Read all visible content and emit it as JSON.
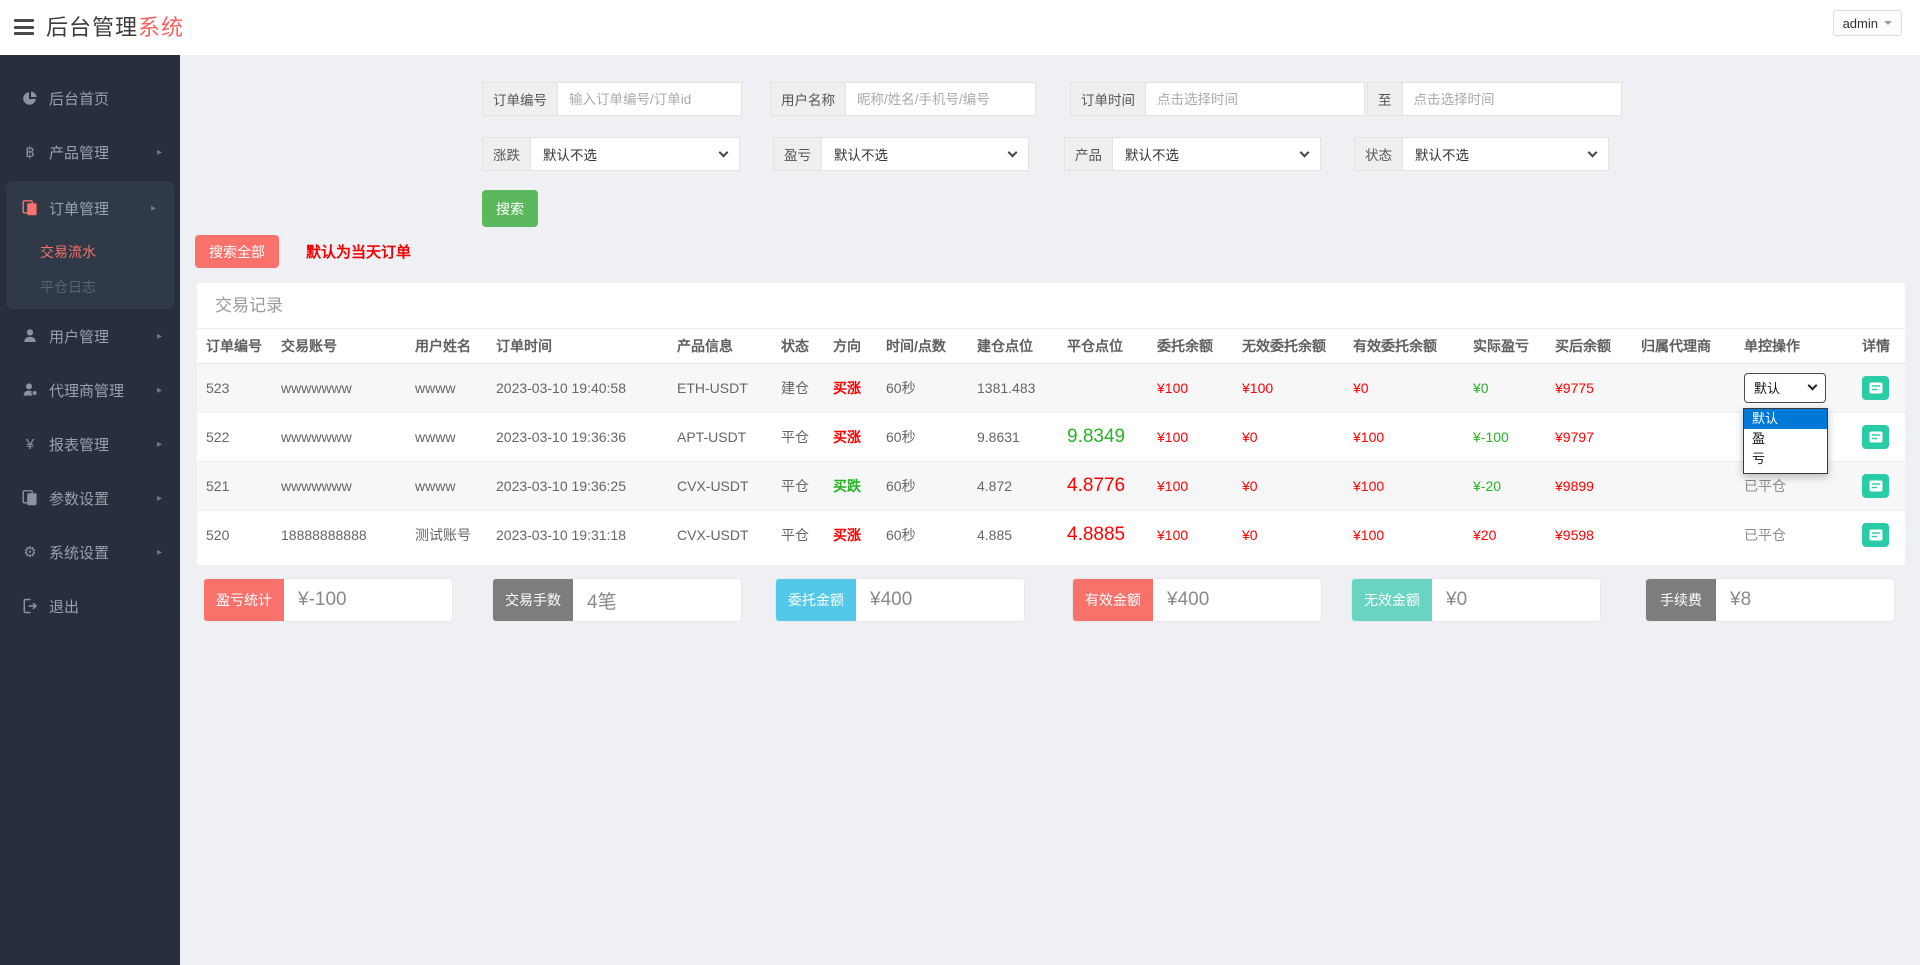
{
  "app": {
    "title_primary": "后台管理",
    "title_accent": "系统",
    "user_menu": "admin"
  },
  "sidebar": {
    "items": [
      {
        "label": "后台首页",
        "icon": "dashboard-icon"
      },
      {
        "label": "产品管理",
        "icon": "product-icon",
        "has_children": true
      },
      {
        "label": "订单管理",
        "icon": "orders-icon",
        "has_children": true,
        "expanded": true,
        "children": [
          {
            "label": "交易流水",
            "active": true
          },
          {
            "label": "平仓日志"
          }
        ]
      },
      {
        "label": "用户管理",
        "icon": "user-icon",
        "has_children": true
      },
      {
        "label": "代理商管理",
        "icon": "agent-icon",
        "has_children": true
      },
      {
        "label": "报表管理",
        "icon": "report-icon",
        "has_children": true
      },
      {
        "label": "参数设置",
        "icon": "params-icon",
        "has_children": true
      },
      {
        "label": "系统设置",
        "icon": "settings-icon",
        "has_children": true
      },
      {
        "label": "退出",
        "icon": "logout-icon"
      }
    ]
  },
  "filters": {
    "order_no": {
      "label": "订单编号",
      "placeholder": "输入订单编号/订单id"
    },
    "user_name": {
      "label": "用户名称",
      "placeholder": "昵称/姓名/手机号/编号"
    },
    "time_range": {
      "label": "订单时间",
      "placeholder_from": "点击选择时间",
      "to": "至",
      "placeholder_to": "点击选择时间"
    },
    "rise_fall": {
      "label": "涨跌",
      "selected": "默认不选"
    },
    "profit_loss": {
      "label": "盈亏",
      "selected": "默认不选"
    },
    "product": {
      "label": "产品",
      "selected": "默认不选"
    },
    "status": {
      "label": "状态",
      "selected": "默认不选"
    },
    "search": "搜索",
    "search_all": "搜索全部",
    "hint": "默认为当天订单"
  },
  "table": {
    "title": "交易记录",
    "columns": [
      "订单编号",
      "交易账号",
      "用户姓名",
      "订单时间",
      "产品信息",
      "状态",
      "方向",
      "时间/点数",
      "建仓点位",
      "平仓点位",
      "委托余额",
      "无效委托余额",
      "有效委托余额",
      "实际盈亏",
      "买后余额",
      "归属代理商",
      "单控操作",
      "详情"
    ],
    "control_dropdown": {
      "value": "默认",
      "options": [
        "默认",
        "盈",
        "亏"
      ],
      "highlighted": "默认"
    },
    "closed_label": "已平仓",
    "rows": [
      {
        "id": "523",
        "account": "wwwwwww",
        "username": "wwww",
        "time": "2023-03-10 19:40:58",
        "product": "ETH-USDT",
        "status": "建仓",
        "direction": "买涨",
        "period": "60秒",
        "open_point": "1381.483",
        "close_point": "",
        "entrust": "¥100",
        "invalid_entrust": "¥100",
        "valid_entrust": "¥0",
        "profit": "¥0",
        "balance": "¥9775",
        "agent": "",
        "control": "dropdown"
      },
      {
        "id": "522",
        "account": "wwwwwww",
        "username": "wwww",
        "time": "2023-03-10 19:36:36",
        "product": "APT-USDT",
        "status": "平仓",
        "direction": "买涨",
        "period": "60秒",
        "open_point": "9.8631",
        "close_point": "9.8349",
        "entrust": "¥100",
        "invalid_entrust": "¥0",
        "valid_entrust": "¥100",
        "profit": "¥-100",
        "balance": "¥9797",
        "agent": "",
        "control": ""
      },
      {
        "id": "521",
        "account": "wwwwwww",
        "username": "wwww",
        "time": "2023-03-10 19:36:25",
        "product": "CVX-USDT",
        "status": "平仓",
        "direction": "买跌",
        "period": "60秒",
        "open_point": "4.872",
        "close_point": "4.8776",
        "entrust": "¥100",
        "invalid_entrust": "¥0",
        "valid_entrust": "¥100",
        "profit": "¥-20",
        "balance": "¥9899",
        "agent": "",
        "control": "已平仓"
      },
      {
        "id": "520",
        "account": "18888888888",
        "username": "测试账号",
        "time": "2023-03-10 19:31:18",
        "product": "CVX-USDT",
        "status": "平仓",
        "direction": "买涨",
        "period": "60秒",
        "open_point": "4.885",
        "close_point": "4.8885",
        "entrust": "¥100",
        "invalid_entrust": "¥0",
        "valid_entrust": "¥100",
        "profit": "¥20",
        "balance": "¥9598",
        "agent": "",
        "control": "已平仓"
      }
    ]
  },
  "stats": [
    {
      "label": "盈亏统计",
      "value": "¥-100",
      "color": "#f8716a"
    },
    {
      "label": "交易手数",
      "value": "4笔",
      "color": "#7d7d7d"
    },
    {
      "label": "委托金额",
      "value": "¥400",
      "color": "#54c8e8"
    },
    {
      "label": "有效金额",
      "value": "¥400",
      "color": "#f8716a"
    },
    {
      "label": "无效金额",
      "value": "¥0",
      "color": "#69d4c1"
    },
    {
      "label": "手续费",
      "value": "¥8",
      "color": "#7d7d7d"
    }
  ],
  "colors": {
    "accent_red": "#f86360",
    "value_red": "#ff0000",
    "value_green": "#27b327",
    "search_green": "#5cb85c",
    "detail_teal": "#2acca7",
    "select_highlight": "#0078d7"
  }
}
